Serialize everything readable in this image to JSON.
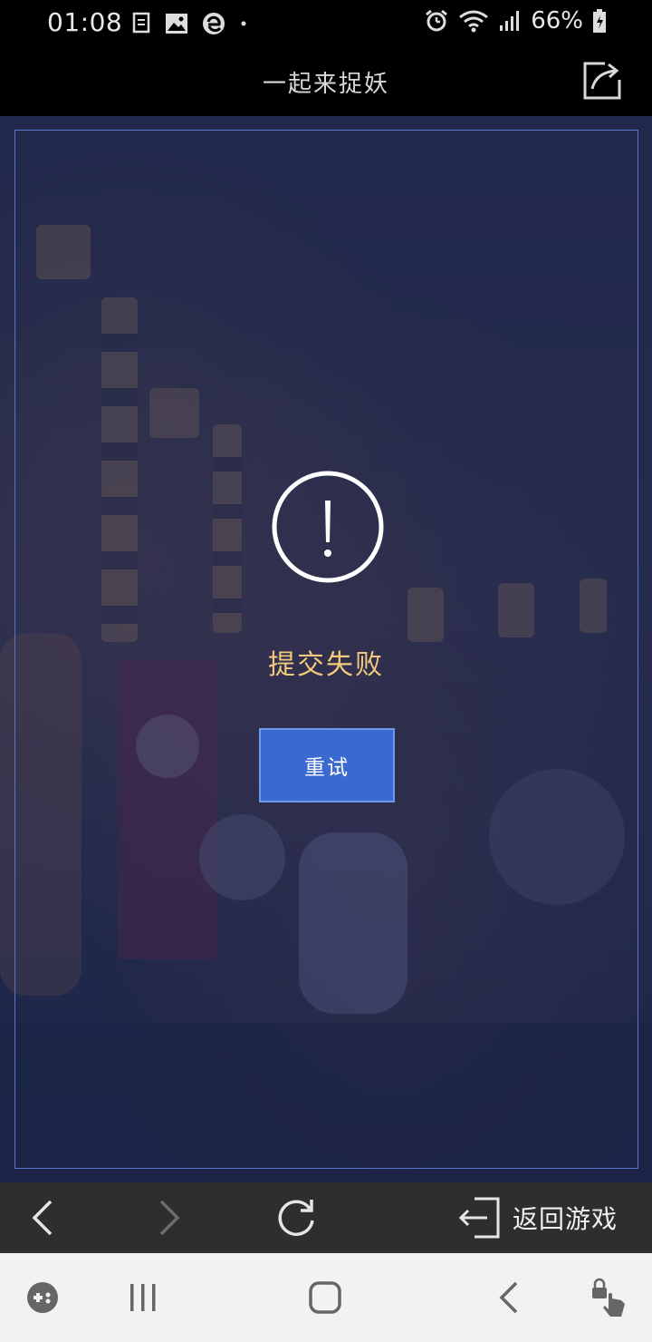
{
  "status_bar": {
    "time": "01:08",
    "battery_percent": "66%",
    "left_icons": [
      "document-icon",
      "image-icon",
      "edge-icon",
      "dot-icon"
    ],
    "right_icons": [
      "alarm-icon",
      "wifi-icon",
      "signal-icon",
      "battery-icon"
    ]
  },
  "title_bar": {
    "title": "一起来捉妖",
    "share_icon": "share-icon"
  },
  "dialog": {
    "icon": "exclamation-circle-icon",
    "message": "提交失败",
    "retry_label": "重试",
    "accent_color": "#f1c97a",
    "button_color": "#3a6ad0"
  },
  "browser_nav": {
    "back_icon": "chevron-left-icon",
    "forward_icon": "chevron-right-icon",
    "refresh_icon": "refresh-icon",
    "back_to_game_label": "返回游戏"
  },
  "system_nav": {
    "items": [
      "game-launcher-icon",
      "recents-icon",
      "home-icon",
      "back-icon",
      "lock-touch-icon"
    ]
  }
}
